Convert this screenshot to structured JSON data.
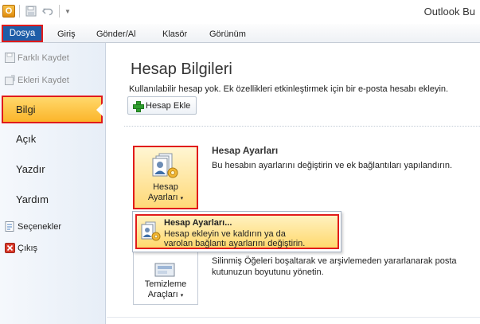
{
  "window": {
    "app_title": "Outlook Bu",
    "qat_icon_letter": "O"
  },
  "ribbon": {
    "tabs": [
      {
        "label": "Dosya"
      },
      {
        "label": "Giriş"
      },
      {
        "label": "Gönder/Al"
      },
      {
        "label": "Klasör"
      },
      {
        "label": "Görünüm"
      }
    ]
  },
  "nav": {
    "save_as": "Farklı Kaydet",
    "save_attachments": "Ekleri Kaydet",
    "info": "Bilgi",
    "open": "Açık",
    "print": "Yazdır",
    "help": "Yardım",
    "options": "Seçenekler",
    "exit": "Çıkış"
  },
  "main": {
    "title": "Hesap Bilgileri",
    "subtitle": "Kullanılabilir hesap yok. Ek özellikleri etkinleştirmek için bir e-posta hesabı ekleyin.",
    "add_account": "Hesap Ekle",
    "account_settings": {
      "button_line1": "Hesap",
      "button_line2": "Ayarları",
      "title": "Hesap Ayarları",
      "description": "Bu hesabın ayarlarını değiştirin ve ek bağlantıları yapılandırın."
    },
    "menu": {
      "item_title": "Hesap Ayarları...",
      "item_desc_line1": "Hesap ekleyin ve kaldırın ya da",
      "item_desc_line2": "varolan bağlantı ayarlarını değiştirin."
    },
    "cleanup": {
      "button_line1": "Temizleme",
      "button_line2": "Araçları",
      "desc_line1": "Silinmiş Öğeleri boşaltarak ve arşivlemeden yararlanarak posta",
      "desc_line2": "kutunuzun boyutunu yönetin."
    }
  }
}
